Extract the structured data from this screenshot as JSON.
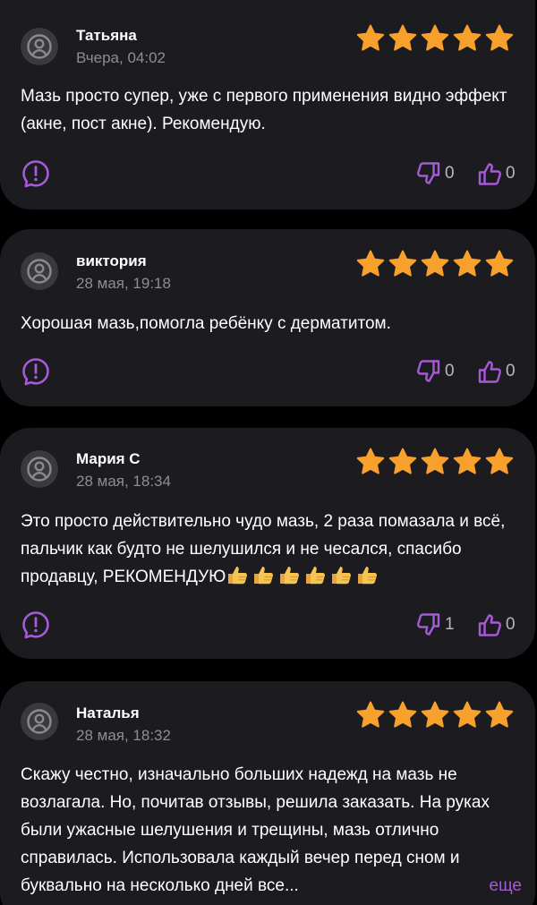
{
  "accent_color": "#a55ad6",
  "star_color": "#f7a02b",
  "reviews": [
    {
      "author": "Татьяна",
      "date": "Вчера, 04:02",
      "rating": 5,
      "text": "Мазь просто супер, уже с первого применения видно эффект (акне, пост акне). Рекомендую.",
      "dislikes": "0",
      "likes": "0"
    },
    {
      "author": "виктория",
      "date": "28 мая, 19:18",
      "rating": 5,
      "text": "Хорошая мазь,помогла ребёнку с дерматитом.",
      "dislikes": "0",
      "likes": "0"
    },
    {
      "author": "Мария С",
      "date": "28 мая, 18:34",
      "rating": 5,
      "text": "Это просто действительно чудо мазь, 2 раза помазала и всё, пальчик как будто не шелушился и не чесался, спасибо продавцу, РЕКОМЕНДУЮ",
      "emoji": "👍👍👍👍👍👍",
      "dislikes": "1",
      "likes": "0"
    },
    {
      "author": "Наталья",
      "date": "28 мая, 18:32",
      "rating": 5,
      "text": "Скажу честно, изначально больших надежд на мазь не возлагала. Но, почитав отзывы, решила заказать. На руках были ужасные шелушения и трещины, мазь отлично справилась. Использовала каждый вечер перед сном и буквально на несколько дней все...",
      "more": "еще"
    }
  ]
}
